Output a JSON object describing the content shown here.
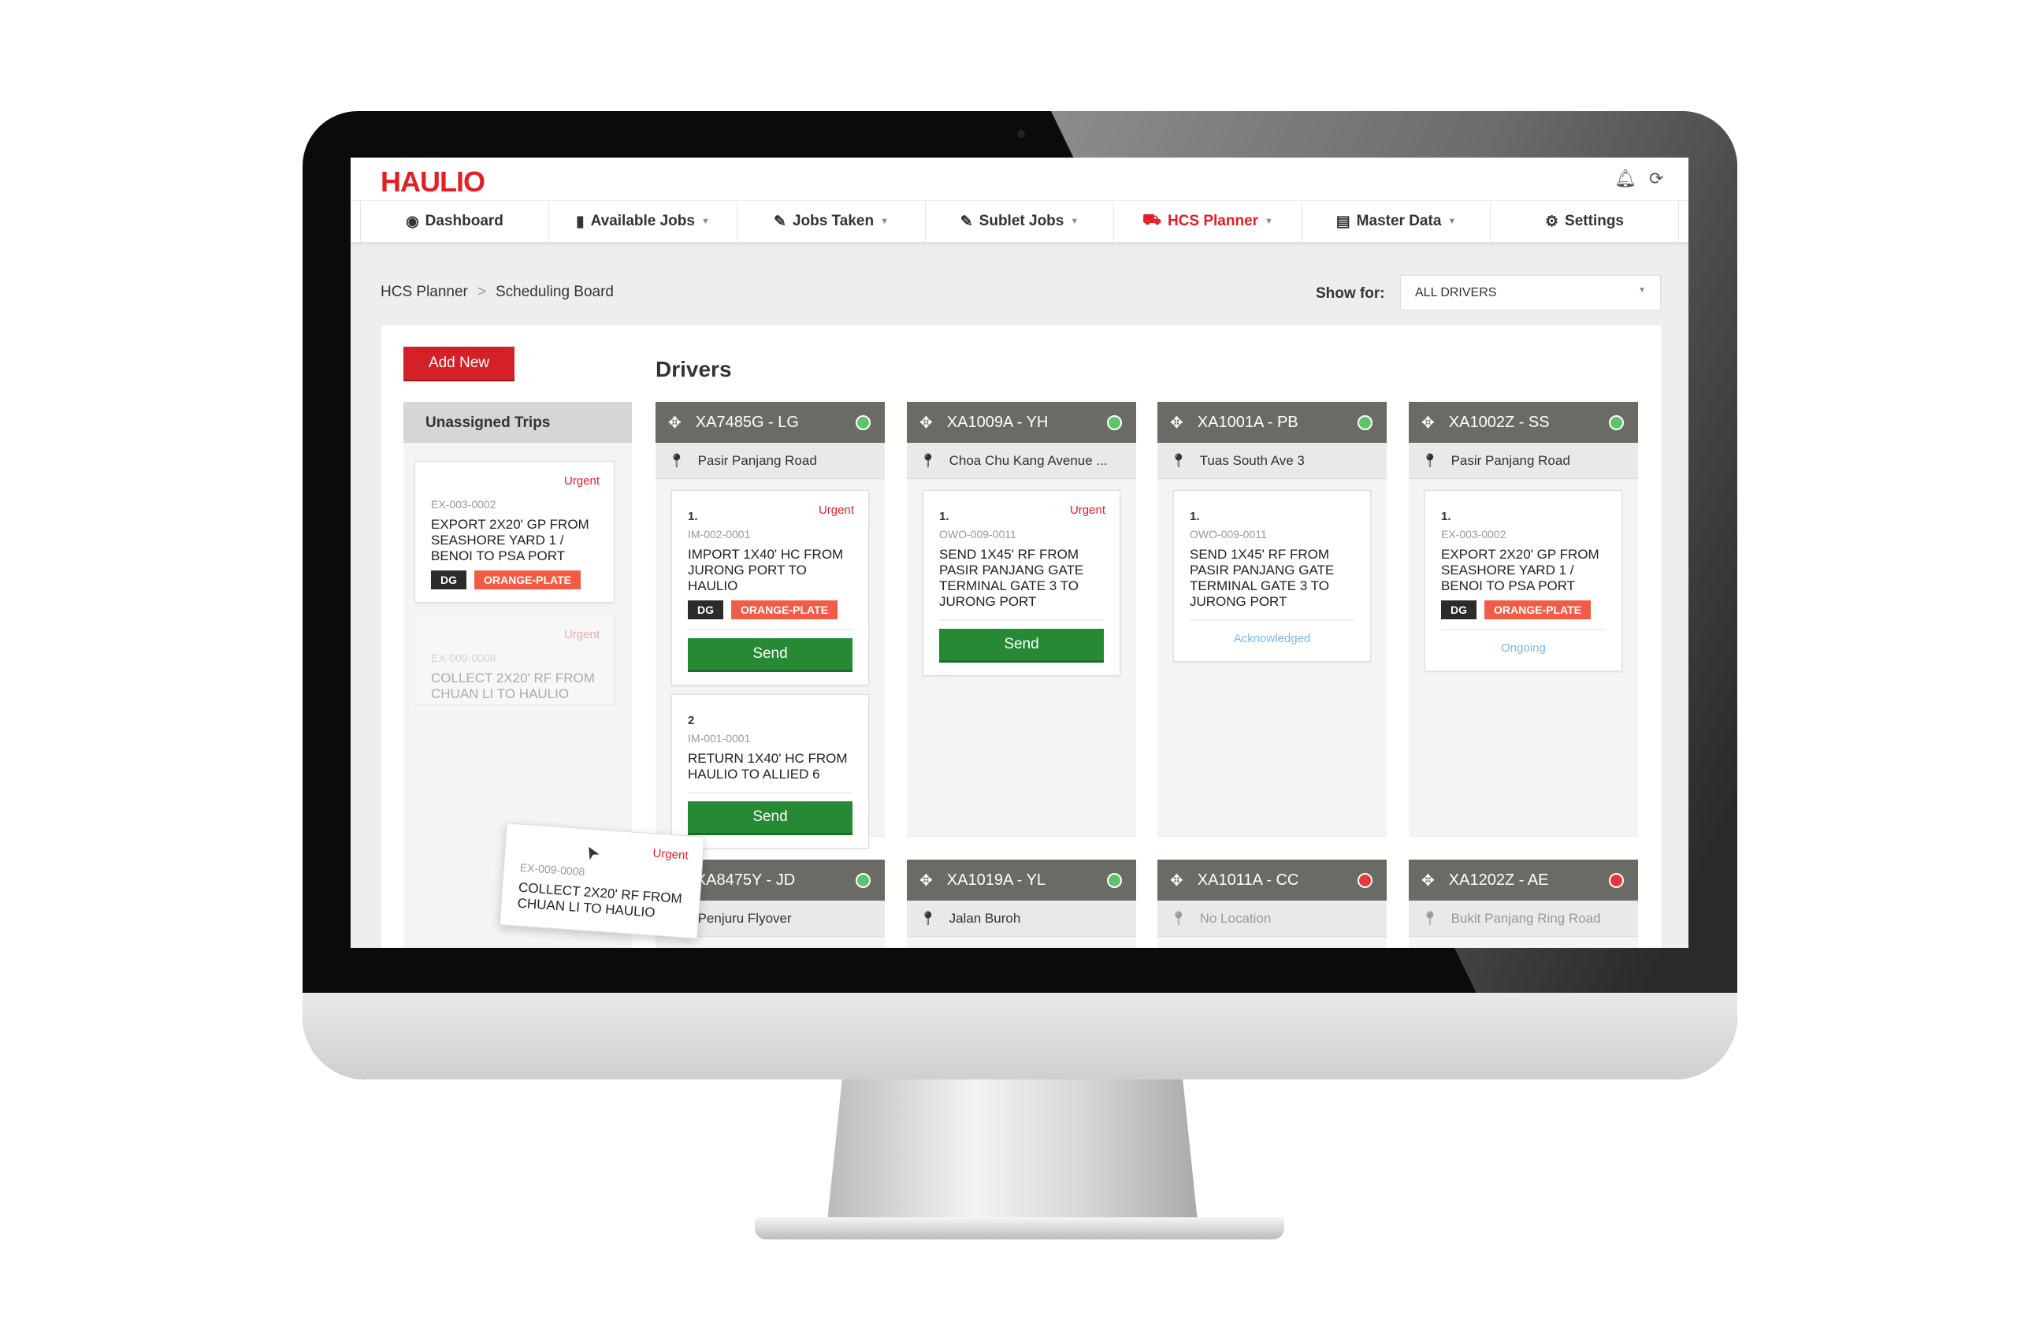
{
  "app": {
    "logo": "HAULIO"
  },
  "nav": [
    {
      "label": "Dashboard",
      "icon": "dashboard-icon",
      "glyph": "◉",
      "caret": false
    },
    {
      "label": "Available Jobs",
      "icon": "truck-icon",
      "glyph": "▮",
      "caret": true
    },
    {
      "label": "Jobs Taken",
      "icon": "pen-icon",
      "glyph": "✎",
      "caret": true
    },
    {
      "label": "Sublet Jobs",
      "icon": "pen-icon",
      "glyph": "✎",
      "caret": true
    },
    {
      "label": "HCS Planner",
      "icon": "truck-icon",
      "glyph": "⛟",
      "caret": true,
      "active": true
    },
    {
      "label": "Master Data",
      "icon": "file-icon",
      "glyph": "▤",
      "caret": true
    },
    {
      "label": "Settings",
      "icon": "gear-icon",
      "glyph": "⚙",
      "caret": false
    }
  ],
  "breadcrumb": {
    "parent": "HCS Planner",
    "sep": ">",
    "current": "Scheduling Board"
  },
  "filter": {
    "label": "Show for:",
    "value": "ALL DRIVERS"
  },
  "add_new": "Add New",
  "drivers_title": "Drivers",
  "unassigned": {
    "title": "Unassigned Trips",
    "cards": [
      {
        "urgent": "Urgent",
        "code": "EX-003-0002",
        "desc": "EXPORT 2x20' GP FROM SEASHORE YARD 1 / BENOI TO PSA PORT",
        "tags": [
          "DG",
          "ORANGE-PLATE"
        ]
      },
      {
        "urgent": "Urgent",
        "code": "EX-009-0008",
        "desc": "COLLECT 2x20' RF FROM CHUAN LI TO HAULIO",
        "tags": []
      }
    ],
    "dragging": {
      "urgent": "Urgent",
      "code": "EX-009-0008",
      "desc": "COLLECT 2x20' RF FROM CHUAN LI TO HAULIO"
    }
  },
  "colors": {
    "online": "#5ec46c",
    "offline": "#e5383b",
    "accent": "#e31e24",
    "send": "#268a35"
  },
  "drivers": [
    {
      "name": "XA7485G - LG",
      "status": "online",
      "location": "Pasir Panjang Road",
      "jobs": [
        {
          "num": "1.",
          "urgent": "Urgent",
          "code": "IM-002-0001",
          "desc": "IMPORT 1x40' HC FROM JURONG PORT TO HAULIO",
          "tags": [
            "DG",
            "ORANGE-PLATE"
          ],
          "action": "Send"
        },
        {
          "num": "2",
          "code": "IM-001-0001",
          "desc": "RETURN 1x40' HC FROM HAULIO TO ALLIED 6",
          "tags": [],
          "action": "Send"
        }
      ]
    },
    {
      "name": "XA1009A - YH",
      "status": "online",
      "location": "Choa Chu Kang Avenue ...",
      "jobs": [
        {
          "num": "1.",
          "urgent": "Urgent",
          "code": "OWO-009-0011",
          "desc": "SEND 1x45' RF FROM PASIR PANJANG GATE TERMINAL GATE 3 TO JURONG PORT",
          "tags": [],
          "action": "Send"
        }
      ]
    },
    {
      "name": "XA1001A - PB",
      "status": "online",
      "location": "Tuas South Ave 3",
      "jobs": [
        {
          "num": "1.",
          "code": "OWO-009-0011",
          "desc": "SEND 1x45' RF FROM PASIR PANJANG GATE TERMINAL GATE 3 TO JURONG PORT",
          "tags": [],
          "status": "Acknowledged"
        }
      ]
    },
    {
      "name": "XA1002Z - SS",
      "status": "online",
      "location": "Pasir Panjang Road",
      "jobs": [
        {
          "num": "1.",
          "code": "EX-003-0002",
          "desc": "EXPORT 2x20' GP FROM SEASHORE YARD 1 / BENOI TO PSA PORT",
          "tags": [
            "DG",
            "ORANGE-PLATE"
          ],
          "status": "Ongoing"
        }
      ]
    },
    {
      "name": "XA8475Y - JD",
      "status": "online",
      "location": "Penjuru Flyover",
      "jobs": []
    },
    {
      "name": "XA1019A - YL",
      "status": "online",
      "location": "Jalan Buroh",
      "jobs": []
    },
    {
      "name": "XA1011A - CC",
      "status": "offline",
      "location": "No Location",
      "jobs": []
    },
    {
      "name": "XA1202Z - AE",
      "status": "offline",
      "location": "Bukit Panjang Ring Road",
      "jobs": []
    }
  ]
}
